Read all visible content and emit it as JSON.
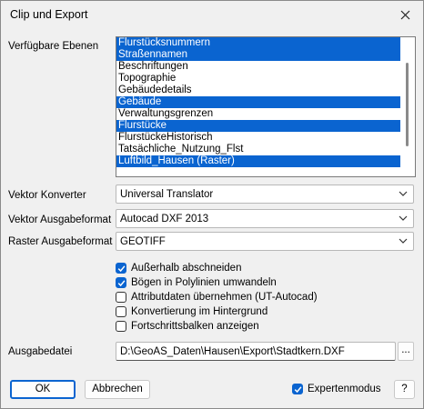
{
  "window": {
    "title": "Clip und Export"
  },
  "layers": {
    "label": "Verfügbare Ebenen",
    "items": [
      {
        "label": "Flurstücksnummern",
        "selected": true
      },
      {
        "label": "Straßennamen",
        "selected": true
      },
      {
        "label": "Beschriftungen",
        "selected": false
      },
      {
        "label": "Topographie",
        "selected": false
      },
      {
        "label": "Gebäudedetails",
        "selected": false
      },
      {
        "label": "Gebäude",
        "selected": true
      },
      {
        "label": "Verwaltungsgrenzen",
        "selected": false
      },
      {
        "label": "Flurstücke",
        "selected": true
      },
      {
        "label": "FlurstückeHistorisch",
        "selected": false
      },
      {
        "label": "Tatsächliche_Nutzung_Flst",
        "selected": false
      },
      {
        "label": "Luftbild_Hausen (Raster)",
        "selected": true
      }
    ]
  },
  "vektor_konverter": {
    "label": "Vektor Konverter",
    "value": "Universal Translator"
  },
  "vektor_format": {
    "label": "Vektor Ausgabeformat",
    "value": "Autocad DXF 2013"
  },
  "raster_format": {
    "label": "Raster Ausgabeformat",
    "value": "GEOTIFF"
  },
  "options": [
    {
      "label": "Außerhalb abschneiden",
      "checked": true
    },
    {
      "label": "Bögen in Polylinien umwandeln",
      "checked": true
    },
    {
      "label": "Attributdaten übernehmen (UT-Autocad)",
      "checked": false
    },
    {
      "label": "Konvertierung im Hintergrund",
      "checked": false
    },
    {
      "label": "Fortschrittsbalken anzeigen",
      "checked": false
    }
  ],
  "output": {
    "label": "Ausgabedatei",
    "value": "D:\\GeoAS_Daten\\Hausen\\Export\\Stadtkern.DXF",
    "browse": "..."
  },
  "footer": {
    "ok": "OK",
    "cancel": "Abbrechen",
    "expert": {
      "label": "Expertenmodus",
      "checked": true
    },
    "help": "?"
  },
  "colors": {
    "accent": "#0a64d0"
  }
}
